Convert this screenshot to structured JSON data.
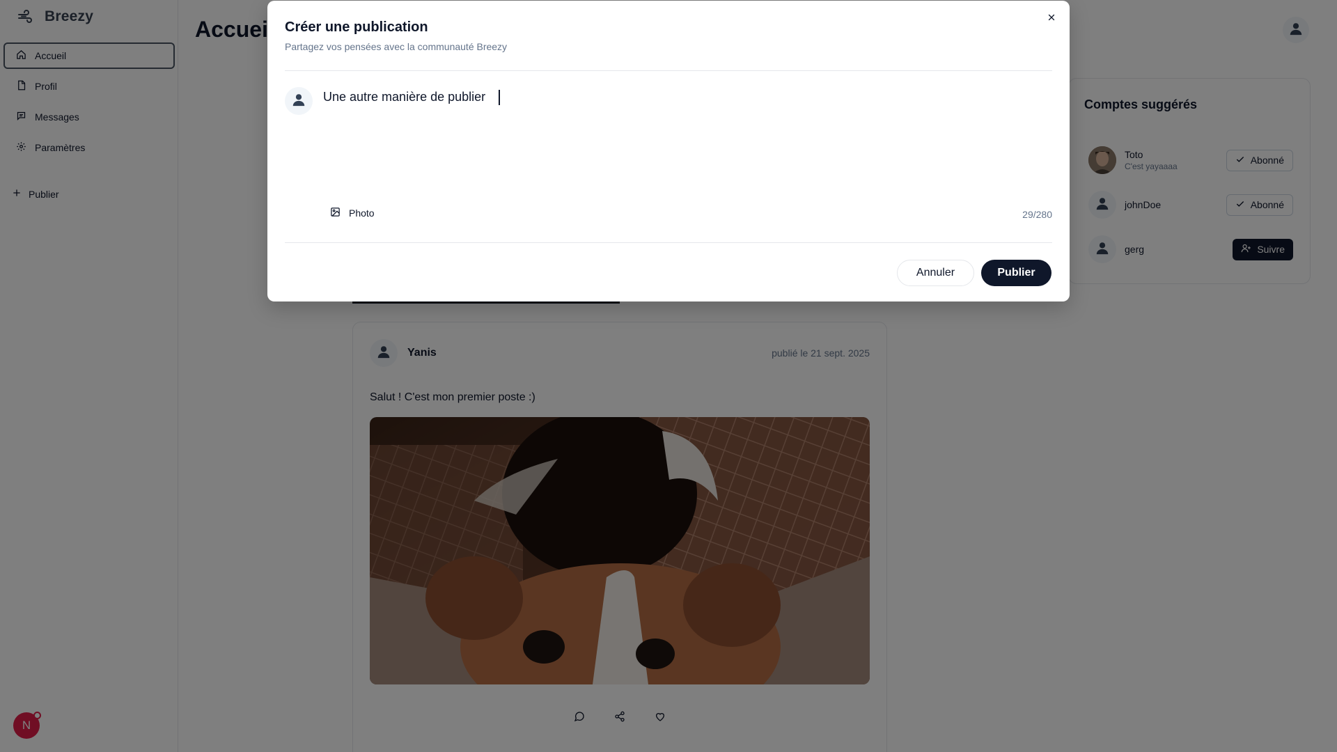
{
  "app": {
    "name": "Breezy"
  },
  "sidebar": {
    "items": [
      {
        "label": "Accueil",
        "icon": "home-icon",
        "active": true
      },
      {
        "label": "Profil",
        "icon": "file-icon"
      },
      {
        "label": "Messages",
        "icon": "message-icon"
      },
      {
        "label": "Paramètres",
        "icon": "gear-icon"
      }
    ],
    "publish_label": "Publier",
    "user_initial": "N"
  },
  "main": {
    "title": "Accueil",
    "post": {
      "author": "Yanis",
      "date": "publié le 21 sept. 2025",
      "text": "Salut ! C'est mon premier poste :)",
      "image_alt": "chiot beagle"
    }
  },
  "suggestions": {
    "title": "Comptes suggérés",
    "accounts": [
      {
        "name": "Toto",
        "bio": "C'est yayaaaa",
        "action": "Abonné"
      },
      {
        "name": "johnDoe",
        "bio": "",
        "action": "Abonné"
      },
      {
        "name": "gerg",
        "bio": "",
        "action": "Suivre"
      }
    ]
  },
  "modal": {
    "title": "Créer une publication",
    "subtitle": "Partagez vos pensées avec la communauté Breezy",
    "text_value": "Une autre manière de publier ",
    "photo_label": "Photo",
    "char_count": "29/280",
    "cancel_label": "Annuler",
    "publish_label": "Publier"
  },
  "colors": {
    "primary": "#0f172a",
    "muted": "#64748b",
    "overlay": "rgba(0,0,0,0.5)",
    "avatar_user": "#e11d48"
  }
}
